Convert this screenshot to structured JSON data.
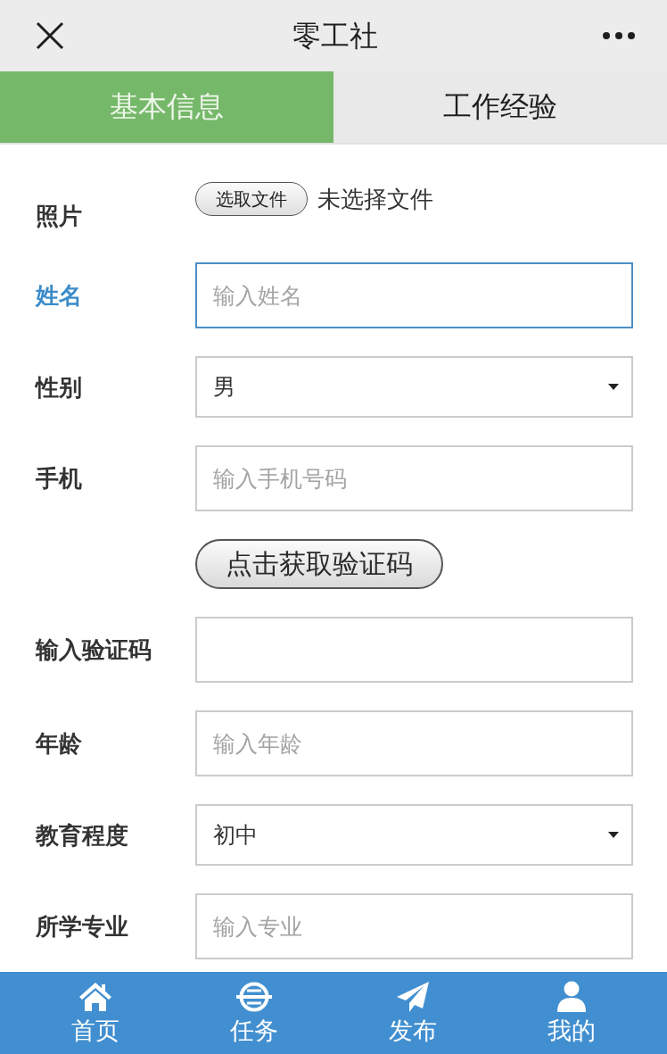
{
  "header": {
    "title": "零工社"
  },
  "tabs": [
    {
      "label": "基本信息",
      "selected": true
    },
    {
      "label": "工作经验",
      "selected": false
    }
  ],
  "form": {
    "rows": [
      {
        "kind": "file",
        "label": "照片",
        "button": "选取文件",
        "status": "未选择文件"
      },
      {
        "kind": "input",
        "label": "姓名",
        "placeholder": "输入姓名",
        "focused": true
      },
      {
        "kind": "select",
        "label": "性别",
        "value": "男",
        "focused": false
      },
      {
        "kind": "input",
        "label": "手机",
        "placeholder": "输入手机号码",
        "focused": false
      },
      {
        "kind": "button",
        "button": "点击获取验证码"
      },
      {
        "kind": "input",
        "label": "输入验证码",
        "focused": false
      },
      {
        "kind": "input",
        "label": "年龄",
        "placeholder": "输入年龄",
        "focused": false
      },
      {
        "kind": "select",
        "label": "教育程度",
        "value": "初中",
        "focused": false
      },
      {
        "kind": "input",
        "label": "所学专业",
        "placeholder": "输入专业",
        "focused": false
      }
    ]
  },
  "nav": [
    {
      "label": "首页"
    },
    {
      "label": "任务"
    },
    {
      "label": "发布"
    },
    {
      "label": "我的"
    }
  ]
}
